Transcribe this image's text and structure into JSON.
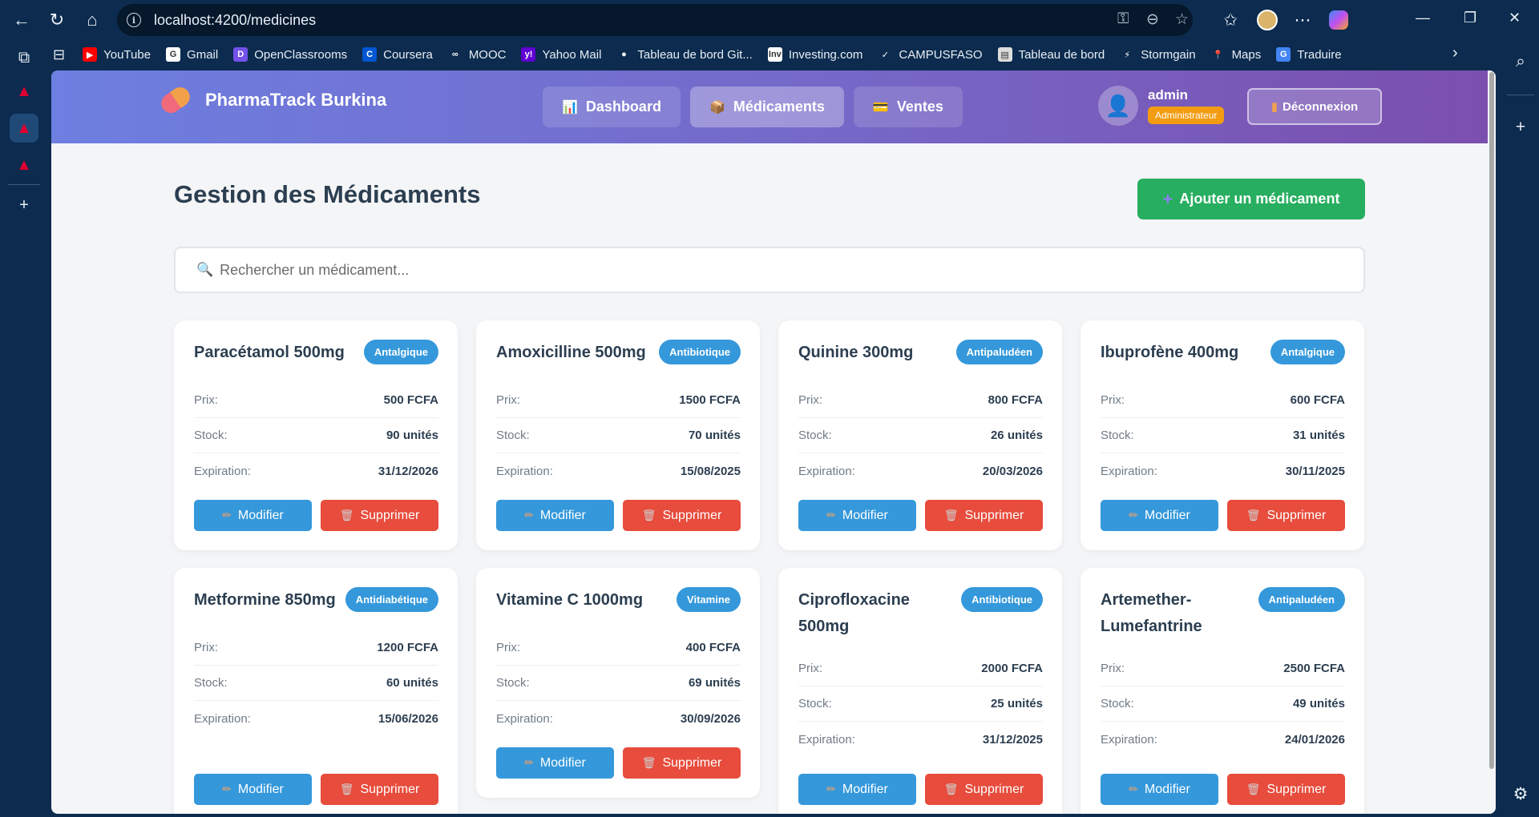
{
  "browser": {
    "url": "localhost:4200/medicines",
    "bookmarks": [
      {
        "label": "YouTube",
        "icon": "youtube-icon",
        "color": "#ff0000",
        "glyph": "▶"
      },
      {
        "label": "Gmail",
        "icon": "google-icon",
        "color": "#ffffff",
        "glyph": "G"
      },
      {
        "label": "OpenClassrooms",
        "icon": "openclassrooms-icon",
        "color": "#7451eb",
        "glyph": "D"
      },
      {
        "label": "Coursera",
        "icon": "coursera-icon",
        "color": "#0056d2",
        "glyph": "C"
      },
      {
        "label": "MOOC",
        "icon": "mooc-icon",
        "color": "#0c2b4e",
        "glyph": "∞"
      },
      {
        "label": "Yahoo Mail",
        "icon": "yahoo-icon",
        "color": "#6001d2",
        "glyph": "y!"
      },
      {
        "label": "Tableau de bord Git...",
        "icon": "github-icon",
        "color": "#0c2b4e",
        "glyph": "●"
      },
      {
        "label": "Investing.com",
        "icon": "investing-icon",
        "color": "#ffffff",
        "glyph": "Inv"
      },
      {
        "label": "CAMPUSFASO",
        "icon": "campusfaso-icon",
        "color": "#0c2b4e",
        "glyph": "✓"
      },
      {
        "label": "Tableau de bord",
        "icon": "dashboard-page-icon",
        "color": "#dddddd",
        "glyph": "▤"
      },
      {
        "label": "Stormgain",
        "icon": "stormgain-icon",
        "color": "#0c2b4e",
        "glyph": "⚡"
      },
      {
        "label": "Maps",
        "icon": "maps-icon",
        "color": "#0c2b4e",
        "glyph": "📍"
      },
      {
        "label": "Traduire",
        "icon": "translate-icon",
        "color": "#4285f4",
        "glyph": "G"
      }
    ]
  },
  "app": {
    "brand": "PharmaTrack Burkina",
    "nav": [
      {
        "label": "Dashboard",
        "icon": "chart-icon",
        "glyph": "📊",
        "active": false
      },
      {
        "label": "Médicaments",
        "icon": "box-icon",
        "glyph": "📦",
        "active": true
      },
      {
        "label": "Ventes",
        "icon": "card-icon",
        "glyph": "💳",
        "active": false
      }
    ],
    "user": {
      "name": "admin",
      "role": "Administrateur"
    },
    "logout_label": "Déconnexion"
  },
  "page": {
    "title": "Gestion des Médicaments",
    "add_label": "Ajouter un médicament",
    "search_placeholder": "Rechercher un médicament...",
    "labels": {
      "price": "Prix:",
      "stock": "Stock:",
      "expiration": "Expiration:",
      "edit": "Modifier",
      "delete": "Supprimer"
    },
    "medicines": [
      {
        "name": "Paracétamol 500mg",
        "category": "Antalgique",
        "price": "500 FCFA",
        "stock": "90 unités",
        "expiration": "31/12/2026"
      },
      {
        "name": "Amoxicilline 500mg",
        "category": "Antibiotique",
        "price": "1500 FCFA",
        "stock": "70 unités",
        "expiration": "15/08/2025"
      },
      {
        "name": "Quinine 300mg",
        "category": "Antipaludéen",
        "price": "800 FCFA",
        "stock": "26 unités",
        "expiration": "20/03/2026"
      },
      {
        "name": "Ibuprofène 400mg",
        "category": "Antalgique",
        "price": "600 FCFA",
        "stock": "31 unités",
        "expiration": "30/11/2025"
      },
      {
        "name": "Metformine 850mg",
        "category": "Antidiabétique",
        "price": "1200 FCFA",
        "stock": "60 unités",
        "expiration": "15/06/2026"
      },
      {
        "name": "Vitamine C 1000mg",
        "category": "Vitamine",
        "price": "400 FCFA",
        "stock": "69 unités",
        "expiration": "30/09/2026"
      },
      {
        "name": "Ciprofloxacine 500mg",
        "category": "Antibiotique",
        "price": "2000 FCFA",
        "stock": "25 unités",
        "expiration": "31/12/2025"
      },
      {
        "name": "Artemether-Lumefantrine",
        "category": "Antipaludéen",
        "price": "2500 FCFA",
        "stock": "49 unités",
        "expiration": "24/01/2026"
      }
    ]
  }
}
